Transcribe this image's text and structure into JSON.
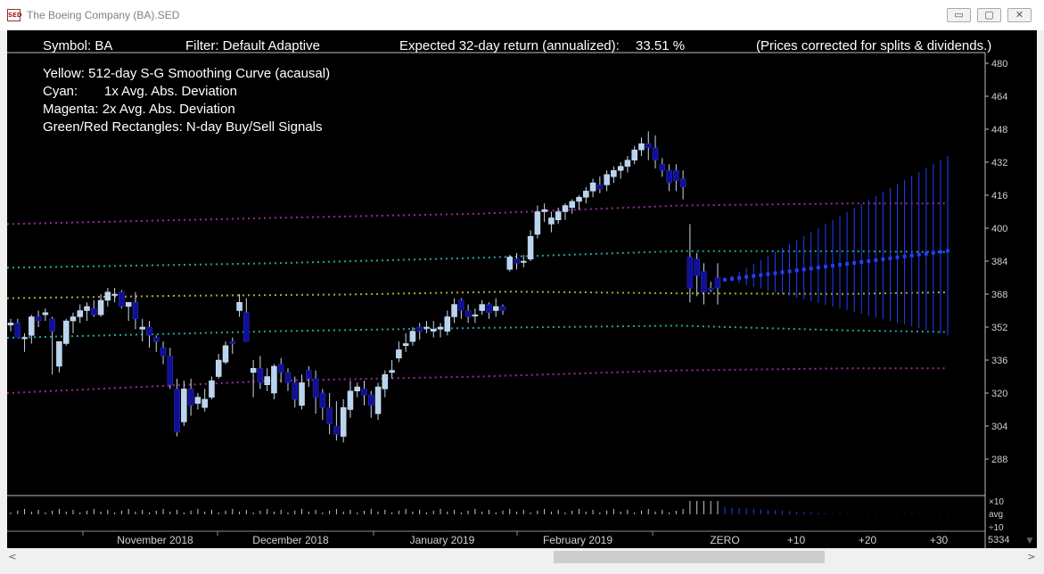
{
  "window": {
    "icon_label": "SED",
    "title": "The Boeing Company (BA).SED",
    "minimize_glyph": "▭",
    "maximize_glyph": "▢",
    "close_glyph": "✕"
  },
  "header": {
    "symbol": "Symbol: BA",
    "filter": "Filter: Default Adaptive",
    "expected_return_label": "Expected 32-day return (annualized):",
    "expected_return_value": "33.51 %",
    "note": "(Prices corrected for splits & dividends.)"
  },
  "legend": {
    "yellow": "Yellow: 512-day S-G Smoothing Curve (acausal)",
    "cyan_key": "Cyan:",
    "cyan_value": "1x Avg. Abs. Deviation",
    "magenta": "Magenta: 2x Avg. Abs. Deviation",
    "rectangles": "Green/Red Rectangles: N-day Buy/Sell Signals"
  },
  "colors": {
    "background": "#000000",
    "up_candle": "#b8d4f0",
    "down_candle": "#0f0f9a",
    "smooth_curve": "#b3a632",
    "one_dev": "#23a3a6",
    "two_dev": "#9a2a9a",
    "forecast": "#1f3fff",
    "axis_text": "#cfcfcf",
    "text": "#ffffff"
  },
  "chart_data": {
    "type": "candlestick",
    "y_axis": {
      "ticks": [
        480,
        464,
        448,
        432,
        416,
        400,
        384,
        368,
        352,
        336,
        320,
        304,
        288
      ],
      "ylim": [
        282,
        482
      ]
    },
    "x_labels": [
      "November 2018",
      "December 2018",
      "January 2019",
      "February 2019",
      "ZERO",
      "+10",
      "+20",
      "+30"
    ],
    "volume_axis": [
      "×10",
      "avg",
      "÷10"
    ],
    "corner_value": "5334",
    "candles": [
      [
        353,
        356,
        350,
        354
      ],
      [
        354,
        356,
        347,
        347
      ],
      [
        347,
        349,
        340,
        347
      ],
      [
        348,
        358,
        344,
        357
      ],
      [
        357,
        360,
        352,
        355
      ],
      [
        358,
        361,
        355,
        359
      ],
      [
        356,
        357,
        329,
        350
      ],
      [
        333,
        345,
        330,
        345
      ],
      [
        344,
        356,
        343,
        355
      ],
      [
        355,
        359,
        349,
        357
      ],
      [
        357,
        363,
        354,
        360
      ],
      [
        360,
        364,
        355,
        362
      ],
      [
        361,
        365,
        357,
        358
      ],
      [
        358,
        368,
        357,
        365
      ],
      [
        365,
        371,
        362,
        369
      ],
      [
        368,
        371,
        364,
        368
      ],
      [
        369,
        370,
        361,
        362
      ],
      [
        362,
        364,
        355,
        364
      ],
      [
        364,
        369,
        351,
        356
      ],
      [
        351,
        356,
        345,
        352
      ],
      [
        352,
        355,
        342,
        348
      ],
      [
        347,
        348,
        340,
        345
      ],
      [
        342,
        345,
        334,
        338
      ],
      [
        338,
        342,
        322,
        324
      ],
      [
        322,
        327,
        299,
        301
      ],
      [
        306,
        326,
        304,
        322
      ],
      [
        322,
        327,
        309,
        314
      ],
      [
        315,
        320,
        312,
        318
      ],
      [
        313,
        322,
        311,
        317
      ],
      [
        318,
        328,
        317,
        326
      ],
      [
        328,
        339,
        327,
        336
      ],
      [
        335,
        345,
        334,
        343
      ],
      [
        345,
        347,
        339,
        344
      ],
      [
        360,
        368,
        357,
        364
      ],
      [
        359,
        366,
        349,
        345
      ],
      [
        330,
        336,
        318,
        332
      ],
      [
        332,
        338,
        322,
        325
      ],
      [
        324,
        332,
        321,
        328
      ],
      [
        320,
        334,
        317,
        333
      ],
      [
        334,
        337,
        325,
        330
      ],
      [
        330,
        332,
        321,
        325
      ],
      [
        325,
        328,
        313,
        317
      ],
      [
        314,
        329,
        312,
        325
      ],
      [
        331,
        333,
        323,
        327
      ],
      [
        327,
        331,
        310,
        318
      ],
      [
        320,
        322,
        307,
        313
      ],
      [
        313,
        320,
        300,
        305
      ],
      [
        304,
        316,
        297,
        300
      ],
      [
        299,
        317,
        296,
        313
      ],
      [
        312,
        326,
        308,
        321
      ],
      [
        321,
        325,
        318,
        323
      ],
      [
        322,
        326,
        314,
        319
      ],
      [
        319,
        321,
        308,
        314
      ],
      [
        310,
        325,
        307,
        323
      ],
      [
        322,
        331,
        318,
        329
      ],
      [
        330,
        336,
        327,
        331
      ],
      [
        337,
        345,
        335,
        341
      ],
      [
        343,
        349,
        340,
        344
      ],
      [
        345,
        352,
        343,
        350
      ],
      [
        352,
        354,
        346,
        350
      ],
      [
        352,
        355,
        349,
        352
      ],
      [
        350,
        355,
        347,
        351
      ],
      [
        351,
        354,
        347,
        352
      ],
      [
        350,
        360,
        348,
        357
      ],
      [
        357,
        366,
        354,
        363
      ],
      [
        365,
        366,
        356,
        360
      ],
      [
        360,
        363,
        354,
        357
      ],
      [
        358,
        361,
        354,
        358
      ],
      [
        360,
        365,
        358,
        363
      ],
      [
        363,
        364,
        356,
        359
      ],
      [
        360,
        366,
        357,
        362
      ],
      [
        362,
        363,
        358,
        360
      ],
      [
        380,
        387,
        379,
        386
      ],
      [
        385,
        388,
        380,
        383
      ],
      [
        384,
        387,
        381,
        384
      ],
      [
        385,
        399,
        384,
        396
      ],
      [
        397,
        411,
        395,
        408
      ],
      [
        408,
        412,
        403,
        409
      ],
      [
        402,
        408,
        398,
        405
      ],
      [
        404,
        410,
        402,
        408
      ],
      [
        408,
        412,
        404,
        411
      ],
      [
        410,
        414,
        407,
        413
      ],
      [
        413,
        416,
        409,
        415
      ],
      [
        415,
        420,
        412,
        418
      ],
      [
        418,
        424,
        415,
        422
      ],
      [
        421,
        425,
        417,
        419
      ],
      [
        421,
        428,
        418,
        426
      ],
      [
        425,
        430,
        422,
        428
      ],
      [
        428,
        432,
        424,
        430
      ],
      [
        430,
        435,
        427,
        433
      ],
      [
        433,
        440,
        431,
        438
      ],
      [
        438,
        444,
        435,
        441
      ],
      [
        441,
        447,
        433,
        439
      ],
      [
        439,
        445,
        429,
        433
      ],
      [
        431,
        434,
        425,
        428
      ],
      [
        428,
        431,
        418,
        422
      ],
      [
        428,
        431,
        418,
        423
      ],
      [
        424,
        428,
        414,
        420
      ],
      [
        386,
        402,
        364,
        371
      ],
      [
        385,
        388,
        367,
        377
      ],
      [
        379,
        383,
        363,
        369
      ],
      [
        371,
        374,
        369,
        370
      ],
      [
        376,
        383,
        363,
        371
      ]
    ],
    "smooth_curve": [
      [
        0,
        366
      ],
      [
        25,
        367.2
      ],
      [
        50,
        367.8
      ],
      [
        75,
        369.2
      ],
      [
        100,
        368.4
      ],
      [
        125,
        368.1
      ],
      [
        140,
        368.9
      ]
    ],
    "one_dev_upper": [
      [
        0,
        380.8
      ],
      [
        40,
        383.0
      ],
      [
        70,
        385.6
      ],
      [
        100,
        388.9
      ],
      [
        125,
        388.8
      ],
      [
        140,
        388.4
      ]
    ],
    "one_dev_lower": [
      [
        0,
        346.8
      ],
      [
        40,
        350.0
      ],
      [
        70,
        351.6
      ],
      [
        100,
        352.7
      ],
      [
        125,
        350.4
      ],
      [
        140,
        349.6
      ]
    ],
    "two_dev_upper": [
      [
        0,
        402
      ],
      [
        40,
        405
      ],
      [
        70,
        407
      ],
      [
        100,
        411
      ],
      [
        125,
        412
      ],
      [
        140,
        412
      ]
    ],
    "two_dev_lower": [
      [
        0,
        320
      ],
      [
        40,
        326
      ],
      [
        70,
        328
      ],
      [
        100,
        331
      ],
      [
        125,
        332
      ],
      [
        140,
        332
      ]
    ],
    "forecast": {
      "start": [
        375,
        375
      ],
      "end": [
        389,
        389
      ],
      "upper_end": 435,
      "lower_end": 348
    }
  },
  "scrollbar": {
    "left_arrow": "<",
    "right_arrow": ">",
    "corner_arrow": "▼"
  }
}
